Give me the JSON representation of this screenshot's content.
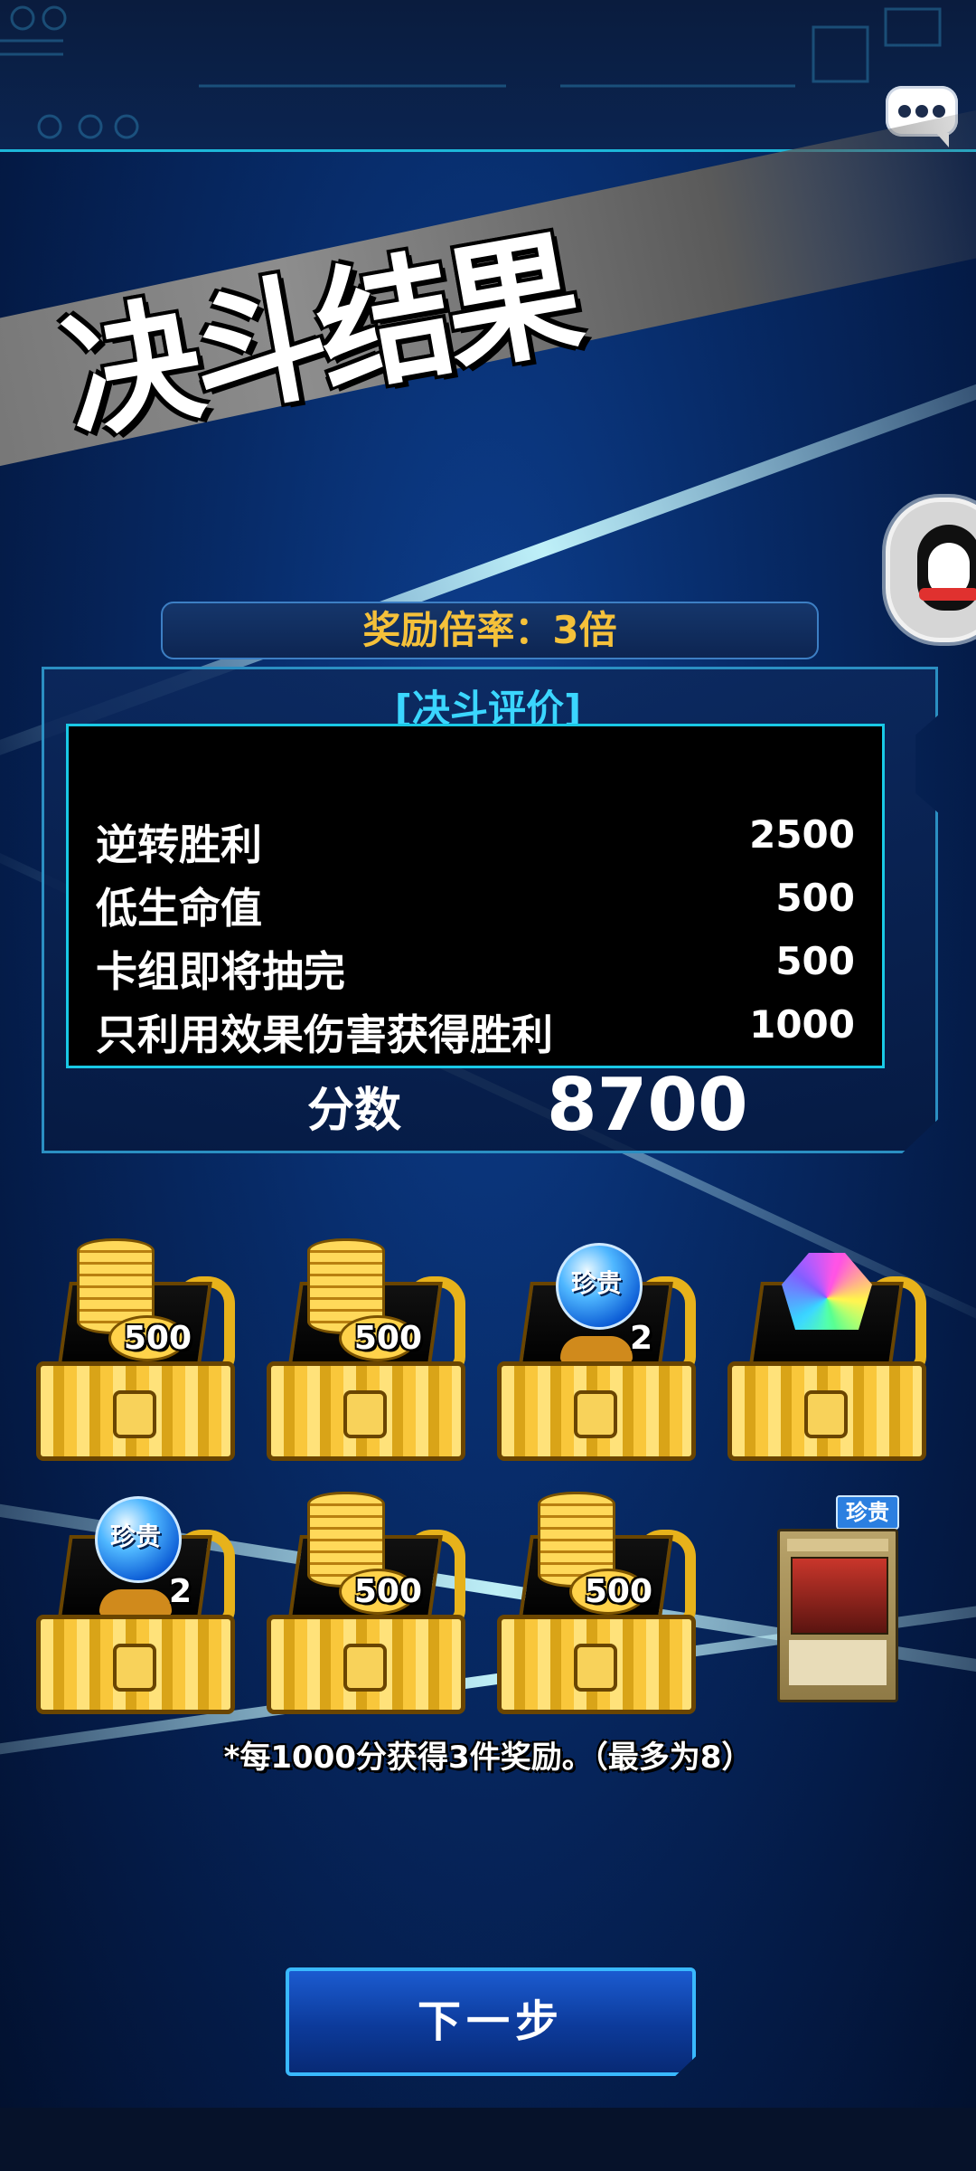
{
  "screen": {
    "title": "决斗结果",
    "multiplier_label": "奖励倍率：3倍"
  },
  "evaluation": {
    "header": "[决斗评价]",
    "rows": [
      {
        "label": "逆转胜利",
        "value": "2500"
      },
      {
        "label": "低生命值",
        "value": "500"
      },
      {
        "label": "卡组即将抽完",
        "value": "500"
      },
      {
        "label": "只利用效果伤害获得胜利",
        "value": "1000"
      }
    ],
    "score_label": "分数",
    "score_value": "8700"
  },
  "rewards": [
    {
      "type": "coins",
      "count": "500"
    },
    {
      "type": "coins",
      "count": "500"
    },
    {
      "type": "rare-orb",
      "badge": "珍贵",
      "count": "2"
    },
    {
      "type": "gem"
    },
    {
      "type": "rare-orb",
      "badge": "珍贵",
      "count": "2"
    },
    {
      "type": "coins",
      "count": "500"
    },
    {
      "type": "coins",
      "count": "500"
    },
    {
      "type": "card",
      "badge": "珍贵"
    }
  ],
  "note": "*每1000分获得3件奖励。（最多为8）",
  "buttons": {
    "next": "下一步"
  },
  "icons": {
    "chat": "chat-bubble-icon",
    "avatar": "penguin-avatar-icon"
  },
  "colors": {
    "multiplier_text": "#f5c13a",
    "eval_header": "#3bd6ff",
    "button_blue": "#1b5bd0"
  }
}
